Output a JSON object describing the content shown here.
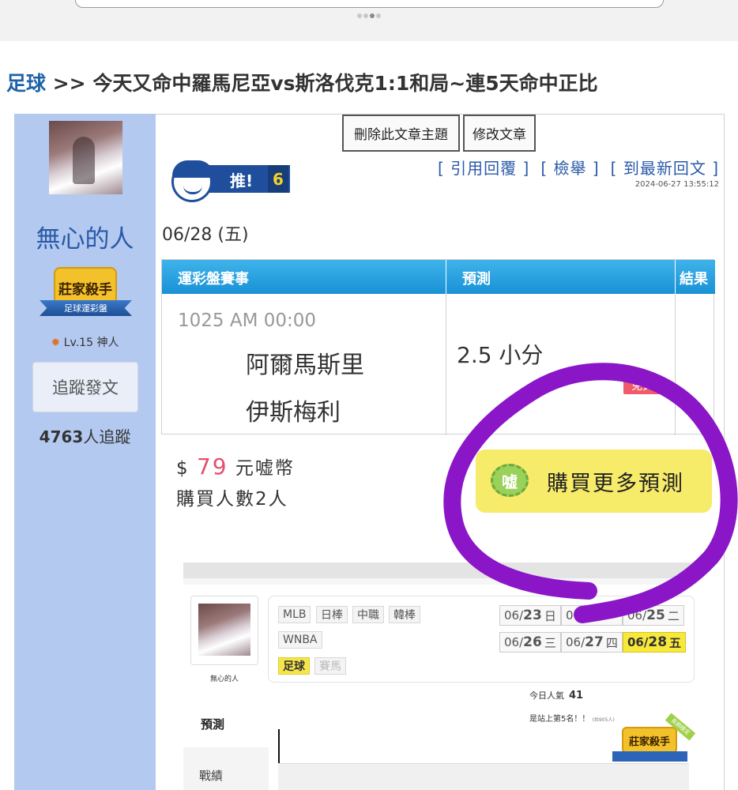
{
  "pager": {
    "total": 4,
    "active": 3
  },
  "title": {
    "category": "足球",
    "separator": " >> ",
    "text": "今天又命中羅馬尼亞vs斯洛伐克1:1和局~連5天命中正比"
  },
  "author": {
    "name": "無心的人",
    "badge_title": "莊家殺手",
    "badge_sub": "足球運彩盤",
    "level": "Lv.15 神人",
    "follow_button": "追蹤發文",
    "followers_count": "4763",
    "followers_suffix": "人追蹤"
  },
  "actions": {
    "delete_topic": "刪除此文章主題",
    "edit_post": "修改文章"
  },
  "push": {
    "label": "推!",
    "count": "6"
  },
  "links": {
    "quote": "[ 引用回覆 ]",
    "report": "[ 檢舉 ]",
    "latest": "[ 到最新回文 ]"
  },
  "timestamp": "2024-06-27 13:55:12",
  "post_date": "06/28 (五)",
  "table": {
    "headers": [
      "運彩盤賽事",
      "預測",
      "結果"
    ],
    "row": {
      "time": "1025 AM 00:00",
      "team_home": "阿爾馬斯里",
      "team_away": "伊斯梅利",
      "prediction": "2.5 小分",
      "result_badge": "免費"
    }
  },
  "price": {
    "currency": "$",
    "amount": "79",
    "unit": "元嘘幣",
    "buyers": "購買人數2人"
  },
  "buy_more": {
    "icon_text": "嘘",
    "label": "購買更多預測"
  },
  "embedded": {
    "username": "無心的人",
    "tabs": {
      "predict": "預測",
      "record": "戰績"
    },
    "leagues": [
      "MLB",
      "日棒",
      "中職",
      "韓棒",
      "WNBA",
      "足球",
      "賽馬"
    ],
    "active_league": "足球",
    "dates": [
      {
        "day": "06/",
        "num": "23",
        "wd": "日"
      },
      {
        "day": "06/",
        "num": "24",
        "wd": "一"
      },
      {
        "day": "06/",
        "num": "25",
        "wd": "二"
      },
      {
        "day": "06/",
        "num": "26",
        "wd": "三"
      },
      {
        "day": "06/",
        "num": "27",
        "wd": "四"
      },
      {
        "day": "06/",
        "num": "28",
        "wd": "五"
      }
    ],
    "popularity_label": "今日人氣",
    "popularity_value": "41",
    "rank_text": "是站上第5名！！",
    "rank_note": "(共905人)",
    "badge_title": "莊家殺手",
    "badge_sub": "足球運彩盤",
    "badge_ribbon": "長期穩定"
  },
  "colors": {
    "accent_blue": "#2a5aa8",
    "sidebar": "#b3c9f0",
    "table_header": "#1891d6",
    "highlight_yellow": "#f7eb6a",
    "annotation_purple": "#8a16c8",
    "price_pink": "#e34f70"
  }
}
